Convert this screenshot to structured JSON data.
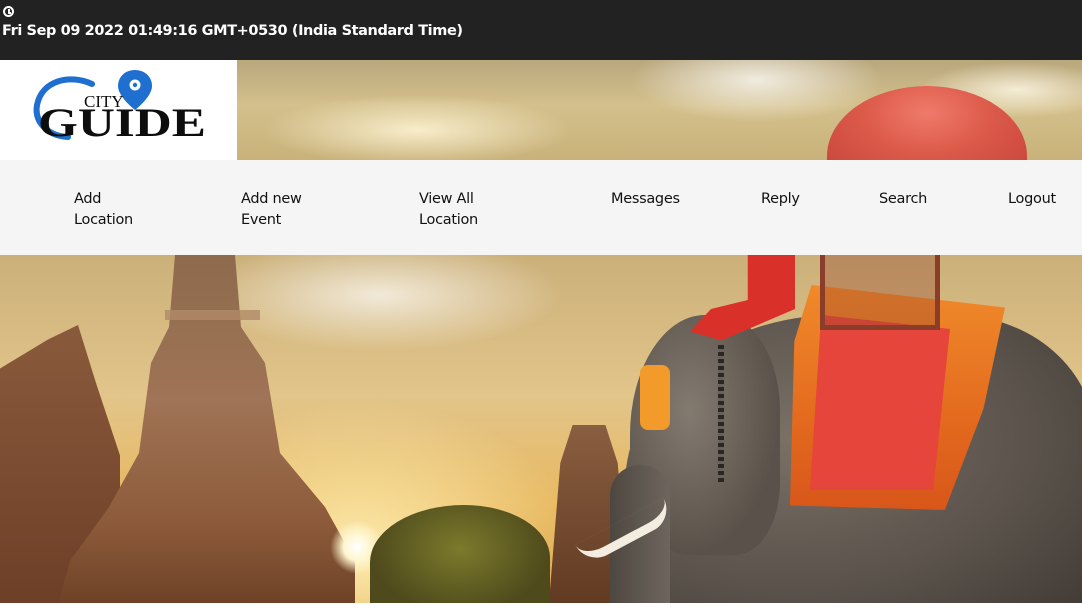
{
  "top_bar": {
    "clock_icon": "clock-icon",
    "datetime": "Fri Sep 09 2022 01:49:16 GMT+0530 (India Standard Time)"
  },
  "logo": {
    "small_text": "CITY",
    "big_text": "GUIDE",
    "pin_icon": "location-pin-icon",
    "colors": {
      "ring": "#1f6fd1",
      "text": "#0d0d0d"
    }
  },
  "nav": {
    "items": [
      {
        "label": "Add\nLocation"
      },
      {
        "label": "Add new\nEvent"
      },
      {
        "label": "View All\nLocation"
      },
      {
        "label": "Messages"
      },
      {
        "label": "Reply"
      },
      {
        "label": "Search"
      },
      {
        "label": "Logout"
      }
    ]
  },
  "colors": {
    "top_bar_bg": "#222222",
    "nav_bg": "#f5f5f5"
  }
}
